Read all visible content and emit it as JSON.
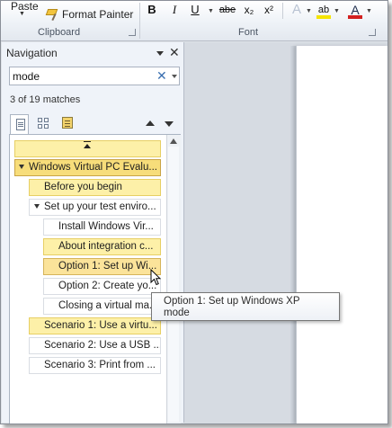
{
  "ribbon": {
    "paste_label": "Paste",
    "format_painter_label": "Format Painter",
    "clipboard_group_label": "Clipboard",
    "font_group_label": "Font",
    "bold_label": "B",
    "italic_label": "I",
    "underline_label": "U",
    "strikethrough_label": "abe",
    "subscript_label": "x₂",
    "superscript_label": "x²",
    "text_effects_label": "A",
    "highlight_label": "ab",
    "font_color_label": "A",
    "highlight_color": "#f5e400",
    "font_color": "#d22020"
  },
  "navigation": {
    "title": "Navigation",
    "search_value": "mode",
    "match_text": "3 of 19 matches",
    "view_tabs": [
      {
        "icon": "browse-headings-icon",
        "active": true
      },
      {
        "icon": "browse-pages-icon",
        "active": false
      },
      {
        "icon": "browse-results-icon",
        "active": false
      }
    ],
    "headings": [
      {
        "label": "Windows Virtual PC Evalu...",
        "state": "selected"
      },
      {
        "label": "Before you begin",
        "state": "match"
      },
      {
        "label": "Set up your test enviro...",
        "state": "normal"
      },
      {
        "label": "Install Windows Vir...",
        "state": "normal"
      },
      {
        "label": "About integration c...",
        "state": "match"
      },
      {
        "label": "Option 1: Set up Wi...",
        "state": "current"
      },
      {
        "label": "Option 2: Create yo...",
        "state": "normal"
      },
      {
        "label": "Closing a virtual ma...",
        "state": "normal"
      },
      {
        "label": "Scenario 1: Use a virtu...",
        "state": "match"
      },
      {
        "label": "Scenario 2: Use a USB ...",
        "state": "normal"
      },
      {
        "label": "Scenario 3: Print from ...",
        "state": "normal"
      }
    ]
  },
  "tooltip": {
    "line1": "Option 1: Set up Windows XP",
    "line2": "mode"
  },
  "colors": {
    "match_highlight": "#fdf0a8",
    "selected_highlight": "#f7dd7a"
  }
}
